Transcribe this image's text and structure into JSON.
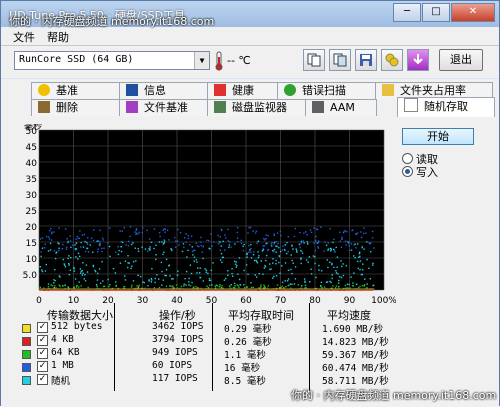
{
  "window": {
    "title": "HD Tune Pro 5.50 - 硬盘/SSD工具",
    "watermark_top": "你的 · 内存硬盘频道 memory.it168.com",
    "watermark_bottom": "你的 · 内存硬盘频道 memory.it168.com"
  },
  "menu": {
    "file": "文件",
    "help": "帮助"
  },
  "toolbar": {
    "drive": "RunCore SSD (64 GB)",
    "temperature": "-- ℃",
    "exit_label": "退出",
    "buttons": [
      "copy-text-icon",
      "copy-screenshot-icon",
      "save-icon",
      "options-icon",
      "download-icon"
    ]
  },
  "tabs": {
    "row1": [
      "基准",
      "信息",
      "健康",
      "错误扫描",
      "文件夹占用率"
    ],
    "row2": [
      "删除",
      "文件基准",
      "磁盘监视器",
      "AAM",
      "随机存取"
    ]
  },
  "side": {
    "start_label": "开始",
    "read_label": "读取",
    "write_label": "写入",
    "selected": "write"
  },
  "chart_data": {
    "type": "scatter",
    "ylabel": "毫秒",
    "yticks": [
      "50",
      "45",
      "40",
      "35",
      "30",
      "25",
      "20",
      "15",
      "10",
      "5.0"
    ],
    "xticks": [
      "0",
      "10",
      "20",
      "30",
      "40",
      "50",
      "60",
      "70",
      "80",
      "90",
      "100%"
    ],
    "ylim": [
      0,
      50
    ],
    "xlim": [
      0,
      100
    ],
    "series": [
      {
        "name": "512 bytes",
        "color": "#f0e020",
        "center": 0.29,
        "spread": 0.6
      },
      {
        "name": "4 KB",
        "color": "#e02020",
        "center": 0.26,
        "spread": 0.4
      },
      {
        "name": "64 KB",
        "color": "#20c020",
        "center": 1.1,
        "spread": 0.8
      },
      {
        "name": "1 MB",
        "color": "#2060e0",
        "center": 16,
        "spread": 4
      },
      {
        "name": "随机",
        "color": "#20d0e0",
        "center": 8.5,
        "spread": 8
      }
    ]
  },
  "table": {
    "headers": [
      "传输数据大小",
      "操作/秒",
      "平均存取时间",
      "平均速度"
    ],
    "rows": [
      {
        "size": "512 bytes",
        "color": "#f0e020",
        "ops": "3462 IOPS",
        "access": "0.29 毫秒",
        "speed": "1.690 MB/秒"
      },
      {
        "size": "4 KB",
        "color": "#e02020",
        "ops": "3794 IOPS",
        "access": "0.26 毫秒",
        "speed": "14.823 MB/秒"
      },
      {
        "size": "64 KB",
        "color": "#20c020",
        "ops": "949 IOPS",
        "access": "1.1 毫秒",
        "speed": "59.367 MB/秒"
      },
      {
        "size": "1 MB",
        "color": "#2060e0",
        "ops": "60 IOPS",
        "access": "16 毫秒",
        "speed": "60.474 MB/秒"
      },
      {
        "size": "随机",
        "color": "#20d0e0",
        "ops": "117 IOPS",
        "access": "8.5 毫秒",
        "speed": "58.711 MB/秒"
      }
    ]
  }
}
